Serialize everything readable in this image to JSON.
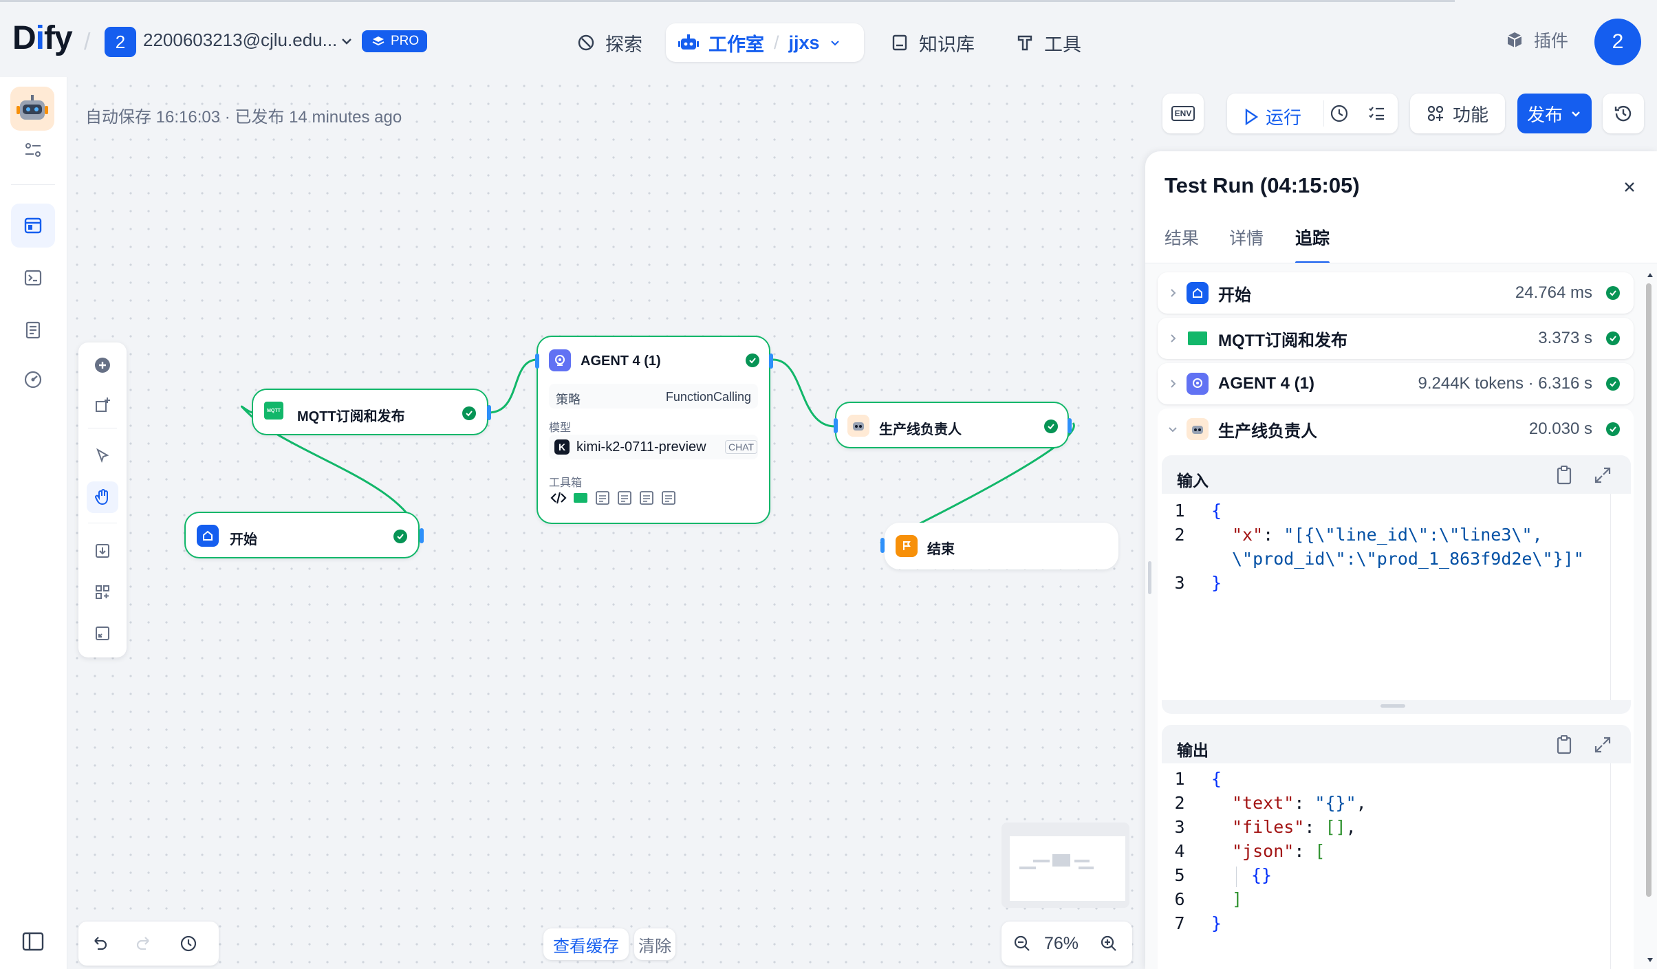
{
  "header": {
    "logo_prefix": "D",
    "logo_i": "i",
    "logo_suffix": "fy",
    "workspace_initial": "2",
    "workspace_name": "2200603213@cjlu.edu...",
    "pro_label": "PRO",
    "nav": {
      "explore": "探索",
      "studio": "工作室",
      "app_name": "jjxs",
      "knowledge": "知识库",
      "tools": "工具"
    },
    "plugins": "插件",
    "avatar_initial": "2"
  },
  "canvas": {
    "autosave": "自动保存 16:16:03 · 已发布 14 minutes ago",
    "zoom": "76%",
    "view_cache": "查看缓存",
    "clear": "清除"
  },
  "toolbar": {
    "env": "ENV",
    "run": "运行",
    "features": "功能",
    "publish": "发布"
  },
  "nodes": {
    "mqtt": {
      "title": "MQTT订阅和发布",
      "icon_text": "MQTT"
    },
    "start": {
      "title": "开始"
    },
    "agent": {
      "title": "AGENT 4 (1)",
      "strategy_label": "策略",
      "strategy_value": "FunctionCalling",
      "model_label": "模型",
      "model_value": "kimi-k2-0711-preview",
      "model_tag": "CHAT",
      "toolbox_label": "工具箱"
    },
    "owner": {
      "title": "生产线负责人"
    },
    "end": {
      "title": "结束"
    }
  },
  "panel": {
    "title": "Test Run (04:15:05)",
    "tabs": [
      "结果",
      "详情",
      "追踪"
    ],
    "active_tab": "追踪",
    "trace": [
      {
        "name": "开始",
        "value": "24.764 ms",
        "status": "success"
      },
      {
        "name": "MQTT订阅和发布",
        "value": "3.373 s",
        "status": "success"
      },
      {
        "name": "AGENT 4 (1)",
        "value": "9.244K tokens · 6.316 s",
        "status": "success"
      },
      {
        "name": "生产线负责人",
        "value": "20.030 s",
        "status": "success"
      }
    ],
    "input_label": "输入",
    "output_label": "输出",
    "input_code": {
      "l1": "{",
      "l2_key": "\"x\"",
      "l2_colon": ": ",
      "l2_val": "\"[{\\\"line_id\\\":\\\"line3\\\",",
      "l2b_val": "\\\"prod_id\\\":\\\"prod_1_863f9d2e\\\"}]\"",
      "l3": "}"
    },
    "output_code": {
      "l1": "{",
      "l2_key": "\"text\"",
      "l2_val": "\"{}\"",
      "l3_key": "\"files\"",
      "l3_val": "[]",
      "l4_key": "\"json\"",
      "l4_val": "[",
      "l5": "{}",
      "l6": "]",
      "l7": "}"
    },
    "line_numbers_in": [
      "1",
      "2",
      "3"
    ],
    "line_numbers_out": [
      "1",
      "2",
      "3",
      "4",
      "5",
      "6",
      "7"
    ]
  },
  "colors": {
    "accent": "#155eef",
    "success": "#079455",
    "edge": "#12b76a"
  }
}
